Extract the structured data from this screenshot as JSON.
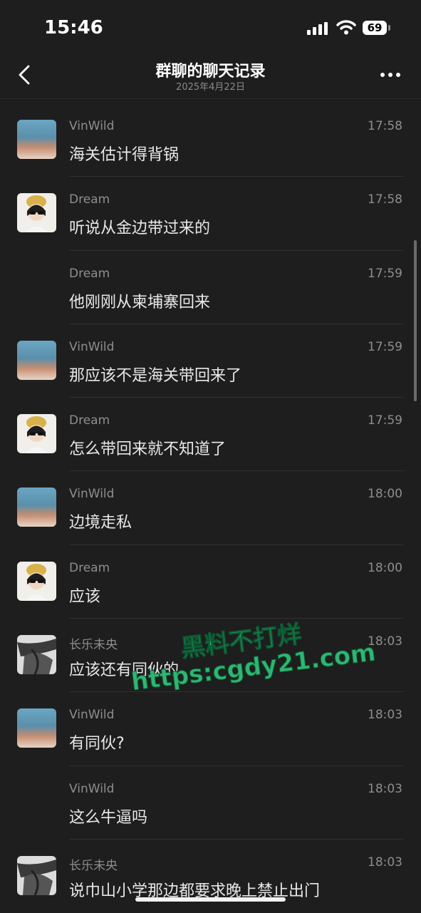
{
  "status": {
    "time": "15:46",
    "battery": "69"
  },
  "nav": {
    "title": "群聊的聊天记录",
    "subtitle": "2025年4月22日"
  },
  "messages": [
    {
      "sender": "VinWild",
      "time": "17:58",
      "text": "海关估计得背锅",
      "avatar": "vinwild"
    },
    {
      "sender": "Dream",
      "time": "17:58",
      "text": "听说从金边带过来的",
      "avatar": "dream"
    },
    {
      "sender": "Dream",
      "time": "17:59",
      "text": "他刚刚从柬埔寨回来",
      "avatar": ""
    },
    {
      "sender": "VinWild",
      "time": "17:59",
      "text": "那应该不是海关带回来了",
      "avatar": "vinwild"
    },
    {
      "sender": "Dream",
      "time": "17:59",
      "text": "怎么带回来就不知道了",
      "avatar": "dream"
    },
    {
      "sender": "VinWild",
      "time": "18:00",
      "text": "边境走私",
      "avatar": "vinwild"
    },
    {
      "sender": "Dream",
      "time": "18:00",
      "text": "应该",
      "avatar": "dream"
    },
    {
      "sender": "长乐未央",
      "time": "18:03",
      "text": "应该还有同伙的",
      "avatar": "changle"
    },
    {
      "sender": "VinWild",
      "time": "18:03",
      "text": "有同伙?",
      "avatar": "vinwild"
    },
    {
      "sender": "VinWild",
      "time": "18:03",
      "text": "这么牛逼吗",
      "avatar": ""
    },
    {
      "sender": "长乐未央",
      "time": "18:03",
      "text": "说巾山小学那边都要求晚上禁止出门",
      "avatar": "changle"
    }
  ],
  "watermark": {
    "line1": "黑料不打烊",
    "line2": "https:cgdy21.com"
  }
}
